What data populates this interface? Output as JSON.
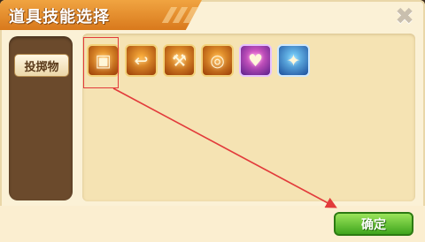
{
  "dialog": {
    "title": "道具技能选择",
    "close_glyph": "✖",
    "confirm_label": "确定"
  },
  "sidebar": {
    "categories": [
      {
        "label": "投掷物"
      }
    ]
  },
  "items": [
    {
      "name": "crate-item",
      "glyph": "▣",
      "style": "orange"
    },
    {
      "name": "hook-item",
      "glyph": "↩",
      "style": "orange"
    },
    {
      "name": "axe-item",
      "glyph": "⚒",
      "style": "orange"
    },
    {
      "name": "ring-item",
      "glyph": "◎",
      "style": "orange"
    },
    {
      "name": "heart-item",
      "glyph": "♥",
      "style": "purple"
    },
    {
      "name": "wolf-item",
      "glyph": "✦",
      "style": "blue"
    }
  ],
  "colors": {
    "title_bar": "#e18a2a",
    "annotation": "#e23b3b",
    "confirm": "#5bbf2a"
  }
}
